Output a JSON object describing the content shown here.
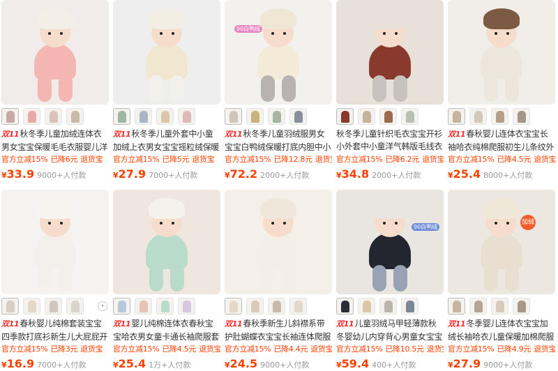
{
  "products": [
    {
      "title": "秋冬季儿童加绒连体衣男女宝宝保暖毛毛衣服婴儿洋气外出",
      "has_double11": true,
      "promos": [
        "官方立减15%",
        "已降6元",
        "退货宝"
      ],
      "price": "33.9",
      "sales": "9000+人付款",
      "colors": {
        "bg": "#f1ecea",
        "body": "#f4b6b2",
        "hat": "#f4efe6",
        "leg": "#f4b6b2"
      },
      "thumb_colors": [
        "#c9a9a6",
        "#e9a7a6",
        "#d9c2b6",
        "#cab9a7"
      ],
      "has_arrow": false
    },
    {
      "title": "秋冬季儿童外套中小童加绒上衣男女宝宝摇粒绒保暖衣服春",
      "has_double11": true,
      "promos": [
        "官方立减15%",
        "已降5元",
        "退货宝"
      ],
      "price": "27.9",
      "sales": "7000+人付款",
      "colors": {
        "bg": "#efeeee",
        "body": "#f1e7d0",
        "hat": "#f3eee3",
        "leg": "#f1f0ec"
      },
      "thumb_colors": [
        "#9fb6a6",
        "#a9b5c3",
        "#d7c8a8",
        "#e2b9b9"
      ],
      "has_arrow": false
    },
    {
      "title": "秋冬季儿童羽绒服男女宝宝白鸭绒保暖打底内胆中小童翻领",
      "has_double11": true,
      "promos": [
        "官方立减15%",
        "已降12.8元",
        "退货宝"
      ],
      "price": "72.2",
      "sales": "2000+人付款",
      "colors": {
        "bg": "#f2f1ee",
        "body": "#f3ead7",
        "hat": "#efe6d4",
        "leg": "#b8b3ae"
      },
      "thumb_colors": [
        "#cfc6b7",
        "#c9b37a",
        "#a9b5a0",
        "#8a8f9c"
      ],
      "has_arrow": false
    },
    {
      "title": "秋冬季儿童针织毛衣宝宝开衫小外套中小童洋气韩版毛线衣男女",
      "has_double11": false,
      "promos": [
        "官方立减15%",
        "已降6.2元",
        "退货宝"
      ],
      "price": "34.8",
      "sales": "2000+人付款",
      "colors": {
        "bg": "#e7e1da",
        "body": "#8a3a2c",
        "hat": "#e7e1da",
        "leg": "#c7c2bd"
      },
      "thumb_colors": [
        "#8a3a2c",
        "#c6b49a",
        "#9a6a4a",
        "#b8c0b4"
      ],
      "has_arrow": false
    },
    {
      "title": "春秋婴儿连体衣宝宝长袖哈衣纯棉爬服初生儿条纹外出服小",
      "has_double11": true,
      "promos": [
        "官方立减15%",
        "已降4.5元",
        "退货宝"
      ],
      "price": "25.4",
      "sales": "8000+人付款",
      "colors": {
        "bg": "#f1eeea",
        "body": "#ece6dc",
        "hat": "#7c5a44",
        "leg": "#ece6dc"
      },
      "thumb_colors": [
        "#c6b39c",
        "#d3c9bb",
        "#b59f8a",
        "#a39686"
      ],
      "has_arrow": false
    },
    {
      "title": "春秋婴儿纯棉套装宝宝四季款打底衫新生儿大屁屁开档裤秋",
      "has_double11": true,
      "promos": [
        "官方立减15%",
        "已降3元",
        "退货宝"
      ],
      "price": "16.9",
      "sales": "7000+人付款",
      "colors": {
        "bg": "#f5f3f1",
        "body": "#f3f0ec",
        "hat": "#f7f4ef",
        "leg": "#f3f0ec"
      },
      "thumb_colors": [
        "#d8cfc5",
        "#e4d8c9",
        "#cfc7bd",
        "#d9d4cc"
      ],
      "has_arrow": true
    },
    {
      "title": "婴儿纯棉连体衣春秋宝宝哈衣男女童卡通长袖爬服套装幼儿",
      "has_double11": true,
      "promos": [
        "官方立减15%",
        "已降4.5元",
        "退货宝"
      ],
      "price": "25.4",
      "sales": "1万+人付款",
      "colors": {
        "bg": "#efe7df",
        "body": "#b9dbc9",
        "hat": "#f5f2ec",
        "leg": "#b9dbc9"
      },
      "thumb_colors": [
        "#b9c7dc",
        "#e7c3b5",
        "#b9dbc9",
        "#d6c7e0"
      ],
      "has_arrow": false
    },
    {
      "title": "春秋季新生儿斜襟系带护肚蝴蝶衣宝宝长袖连体爬服四季款",
      "has_double11": true,
      "promos": [
        "官方立减15%",
        "已降4.4元",
        "退货宝"
      ],
      "price": "24.5",
      "sales": "9000+人付款",
      "colors": {
        "bg": "#f4efe9",
        "body": "#f4efe6",
        "hat": "#efe7d9",
        "leg": "#f4efe6"
      },
      "thumb_colors": [
        "#e5d8c9",
        "#d9cbb9",
        "#c8bca9",
        "#e1d7cc"
      ],
      "has_arrow": false
    },
    {
      "title": "儿童羽绒马甲轻薄款秋冬婴幼儿内穿背心男童女宝宝保暖内胆",
      "has_double11": true,
      "promos": [
        "官方立减15%",
        "已降10.5元",
        "退货宝"
      ],
      "price": "59.4",
      "sales": "400+人付款",
      "colors": {
        "bg": "#e9e6e1",
        "body": "#23262e",
        "hat": "#e9e6e1",
        "leg": "#9aa3b5"
      },
      "thumb_colors": [
        "#2b2e36",
        "#d9c7a6",
        "#b9b4ac",
        "#7c8796"
      ],
      "has_arrow": false
    },
    {
      "title": "冬季婴儿连体衣宝宝加绒长袖哈衣儿童保暖加棉爬服春秋外",
      "has_double11": true,
      "promos": [
        "官方立减15%",
        "已降4.9元",
        "退货宝"
      ],
      "price": "27.9",
      "sales": "9000+人付款",
      "colors": {
        "bg": "#ece7e1",
        "body": "#e9dfd1",
        "hat": "#efe7d7",
        "leg": "#e9dfd1"
      },
      "thumb_colors": [
        "#c9b49f",
        "#b5a594",
        "#d8c9b8",
        "#a99888"
      ],
      "has_arrow": false
    }
  ],
  "labels": {
    "double11": "双11",
    "yen": "¥",
    "next_arrow": "›"
  },
  "overlays": {
    "p3_watermark": "90白鸭绒",
    "p9_watermark": "90白鸭绒",
    "p10_badge": "加绒"
  }
}
